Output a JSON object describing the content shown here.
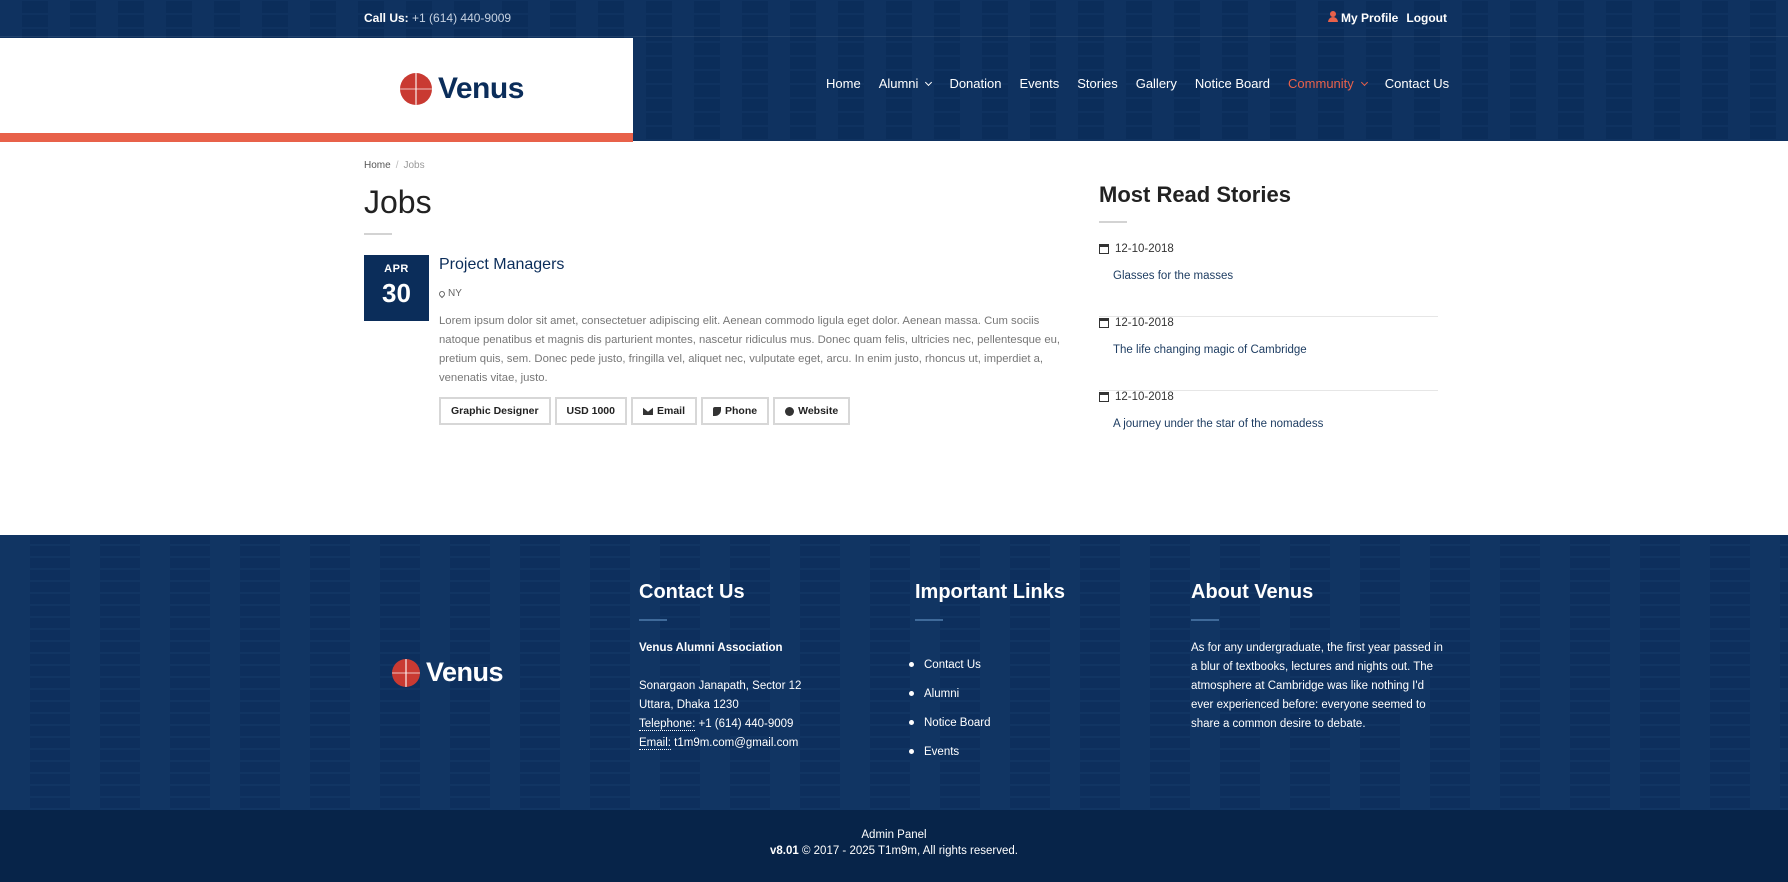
{
  "topbar": {
    "call_label": "Call Us:",
    "call_number": "+1 (614) 440-9009",
    "profile": "My Profile",
    "logout": "Logout"
  },
  "brand": {
    "name": "Venus",
    "accent": "#e8614a",
    "navy": "#0b2d5a"
  },
  "nav": {
    "home": "Home",
    "alumni": "Alumni",
    "donation": "Donation",
    "events": "Events",
    "stories": "Stories",
    "gallery": "Gallery",
    "notice": "Notice Board",
    "community": "Community",
    "contact": "Contact Us"
  },
  "breadcrumb": {
    "home": "Home",
    "sep": "/",
    "current": "Jobs"
  },
  "page": {
    "title": "Jobs"
  },
  "job": {
    "month": "APR",
    "day": "30",
    "title": "Project Managers",
    "location": "NY",
    "description": "Lorem ipsum dolor sit amet, consectetuer adipiscing elit. Aenean commodo ligula eget dolor. Aenean massa. Cum sociis natoque penatibus et magnis dis parturient montes, nascetur ridiculus mus. Donec quam felis, ultricies nec, pellentesque eu, pretium quis, sem. Donec pede justo, fringilla vel, aliquet nec, vulputate eget, arcu. In enim justo, rhoncus ut, imperdiet a, venenatis vitae, justo.",
    "tags": {
      "category": "Graphic Designer",
      "salary": "USD 1000",
      "email": "Email",
      "phone": "Phone",
      "website": "Website"
    }
  },
  "sidebar": {
    "title": "Most Read Stories",
    "stories": [
      {
        "date": "12-10-2018",
        "title": "Glasses for the masses"
      },
      {
        "date": "12-10-2018",
        "title": "The life changing magic of Cambridge"
      },
      {
        "date": "12-10-2018",
        "title": "A journey under the star of the nomadess"
      }
    ]
  },
  "footer": {
    "contact": {
      "title": "Contact Us",
      "org": "Venus Alumni Association",
      "addr1": "Sonargaon Janapath, Sector 12",
      "addr2": "Uttara, Dhaka 1230",
      "tel_label": "Telephone:",
      "tel": "+1 (614) 440-9009",
      "email_label": "Email:",
      "email": "t1m9m.com@gmail.com"
    },
    "links": {
      "title": "Important Links",
      "items": [
        "Contact Us",
        "Alumni",
        "Notice Board",
        "Events"
      ]
    },
    "about": {
      "title": "About Venus",
      "text": "As for any undergraduate, the first year passed in a blur of textbooks, lectures and nights out. The atmosphere at Cambridge was like nothing I'd ever experienced before: everyone seemed to share a common desire to debate."
    }
  },
  "copyright": {
    "admin": "Admin Panel",
    "version": "v8.01",
    "text": "© 2017 - 2025 T1m9m, All rights reserved."
  }
}
